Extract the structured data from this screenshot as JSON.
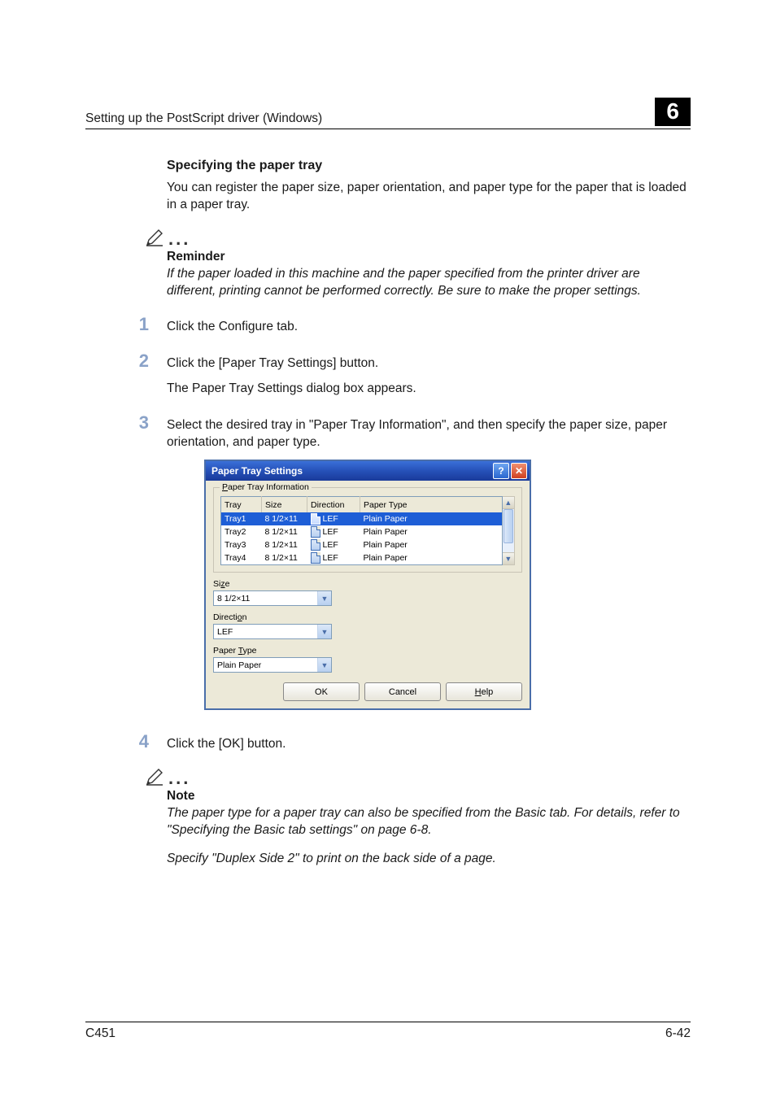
{
  "header": {
    "running_title": "Setting up the PostScript driver (Windows)",
    "chapter_number": "6"
  },
  "heading": "Specifying the paper tray",
  "intro": "You can register the paper size, paper orientation, and paper type for the paper that is loaded in a paper tray.",
  "reminder": {
    "label": "Reminder",
    "body": "If the paper loaded in this machine and the paper specified from the printer driver are different, printing cannot be performed correctly. Be sure to make the proper settings."
  },
  "steps": {
    "n1": "1",
    "s1": "Click the Configure tab.",
    "n2": "2",
    "s2": "Click the [Paper Tray Settings] button.",
    "s2b": "The Paper Tray Settings dialog box appears.",
    "n3": "3",
    "s3": "Select the desired tray in \"Paper Tray Information\", and then specify the paper size, paper orientation, and paper type.",
    "n4": "4",
    "s4": "Click the [OK] button."
  },
  "dialog": {
    "title": "Paper Tray Settings",
    "group_legend_pre": "P",
    "group_legend_rest": "aper Tray Information",
    "cols": {
      "tray": "Tray",
      "size": "Size",
      "direction": "Direction",
      "type": "Paper Type"
    },
    "rows": [
      {
        "tray": "Tray1",
        "size": "8 1/2×11",
        "dir": "LEF",
        "type": "Plain Paper",
        "selected": true
      },
      {
        "tray": "Tray2",
        "size": "8 1/2×11",
        "dir": "LEF",
        "type": "Plain Paper",
        "selected": false
      },
      {
        "tray": "Tray3",
        "size": "8 1/2×11",
        "dir": "LEF",
        "type": "Plain Paper",
        "selected": false
      },
      {
        "tray": "Tray4",
        "size": "8 1/2×11",
        "dir": "LEF",
        "type": "Plain Paper",
        "selected": false
      }
    ],
    "size_label_pre": "Si",
    "size_label_ul": "z",
    "size_label_post": "e",
    "size_value": "8 1/2×11",
    "dir_label_pre": "Directi",
    "dir_label_ul": "o",
    "dir_label_post": "n",
    "dir_value": "LEF",
    "type_label_pre": "Paper ",
    "type_label_ul": "T",
    "type_label_post": "ype",
    "type_value": "Plain Paper",
    "ok": "OK",
    "cancel": "Cancel",
    "help_pre": "",
    "help_ul": "H",
    "help_post": "elp"
  },
  "note": {
    "label": "Note",
    "body1": "The paper type for a paper tray can also be specified from the Basic tab. For details, refer to \"Specifying the Basic tab settings\" on page 6-8.",
    "body2": "Specify \"Duplex Side 2\" to print on the back side of a page."
  },
  "footer": {
    "model": "C451",
    "pageno": "6-42"
  }
}
